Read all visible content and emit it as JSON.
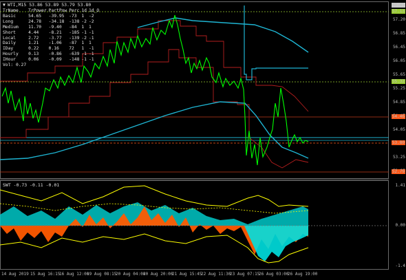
{
  "title_line": "WTI,M15  53.86 53.89 53.79 53.80",
  "indicator_title": "SWT -0.73 -0.11 -0.01",
  "stats_table": {
    "headers": [
      "TrName",
      "TrPower",
      "PartPow",
      "Perc",
      "1d",
      "1d_O"
    ],
    "rows": [
      [
        "Basic",
        "54.65",
        "-39.95",
        "-73",
        "1",
        "-2"
      ],
      [
        "Long",
        "24.78",
        "-34.18",
        "-138",
        "-2",
        "-2"
      ],
      [
        "Medium",
        "11.70",
        "-9.40",
        "-84",
        "1",
        "1"
      ],
      [
        "Short",
        "4.44",
        "-8.21",
        "-185",
        "-1",
        "-1"
      ],
      [
        "Local",
        "2.72",
        "-3.77",
        "-139",
        "-2",
        "-1"
      ],
      [
        "Daily",
        "1.21",
        "-1.06",
        "-87",
        "1",
        "1"
      ],
      [
        "IDay",
        "0.22",
        "0.16",
        "72",
        "1",
        "-1"
      ],
      [
        "Hourly",
        "0.13",
        "-0.86",
        "-639",
        "-1",
        "-1"
      ],
      [
        "IHour",
        "0.06",
        "-0.09",
        "-148",
        "-1",
        "-1"
      ]
    ],
    "footer": "Vol: 0.27"
  },
  "price_axis": {
    "labels": [
      "57.45",
      "57.20",
      "56.85",
      "56.45",
      "56.05",
      "55.65",
      "55.25",
      "54.85",
      "54.45",
      "54.05",
      "53.65",
      "53.25",
      "52.85"
    ],
    "tags": [
      {
        "text": "57.45",
        "color": "#c8c8c8"
      },
      {
        "text": "57.13",
        "color": "#9acd32"
      },
      {
        "text": "55.32",
        "color": "#9acd32"
      },
      {
        "text": "54.46",
        "color": "#ff5a1a"
      },
      {
        "text": "53.80",
        "color": "#ff5a1a"
      },
      {
        "text": "52.79",
        "color": "#ff5a1a"
      }
    ]
  },
  "indicator_axis": {
    "labels": [
      "1.41",
      "0.00",
      "-1.4"
    ]
  },
  "time_axis": {
    "labels": [
      "14 Aug 2019",
      "15 Aug 16:15",
      "16 Aug 12:00",
      "19 Aug 08:15",
      "20 Aug 04:00",
      "20 Aug 20:00",
      "21 Aug 15:45",
      "22 Aug 11:30",
      "23 Aug 07:15",
      "26 Aug 03:00",
      "26 Aug 19:00"
    ]
  },
  "colors": {
    "price_line": "#00ff00",
    "ma_cyan": "#1eb4d2",
    "channel_red": "#b41e1e",
    "level_green": "#9acd32",
    "level_orange": "#ff5a1a",
    "indicator_cyan": "#00ffff",
    "indicator_orange": "#ff5a00",
    "indicator_yellow": "#ffff00",
    "indicator_gray": "#9090b0"
  }
}
